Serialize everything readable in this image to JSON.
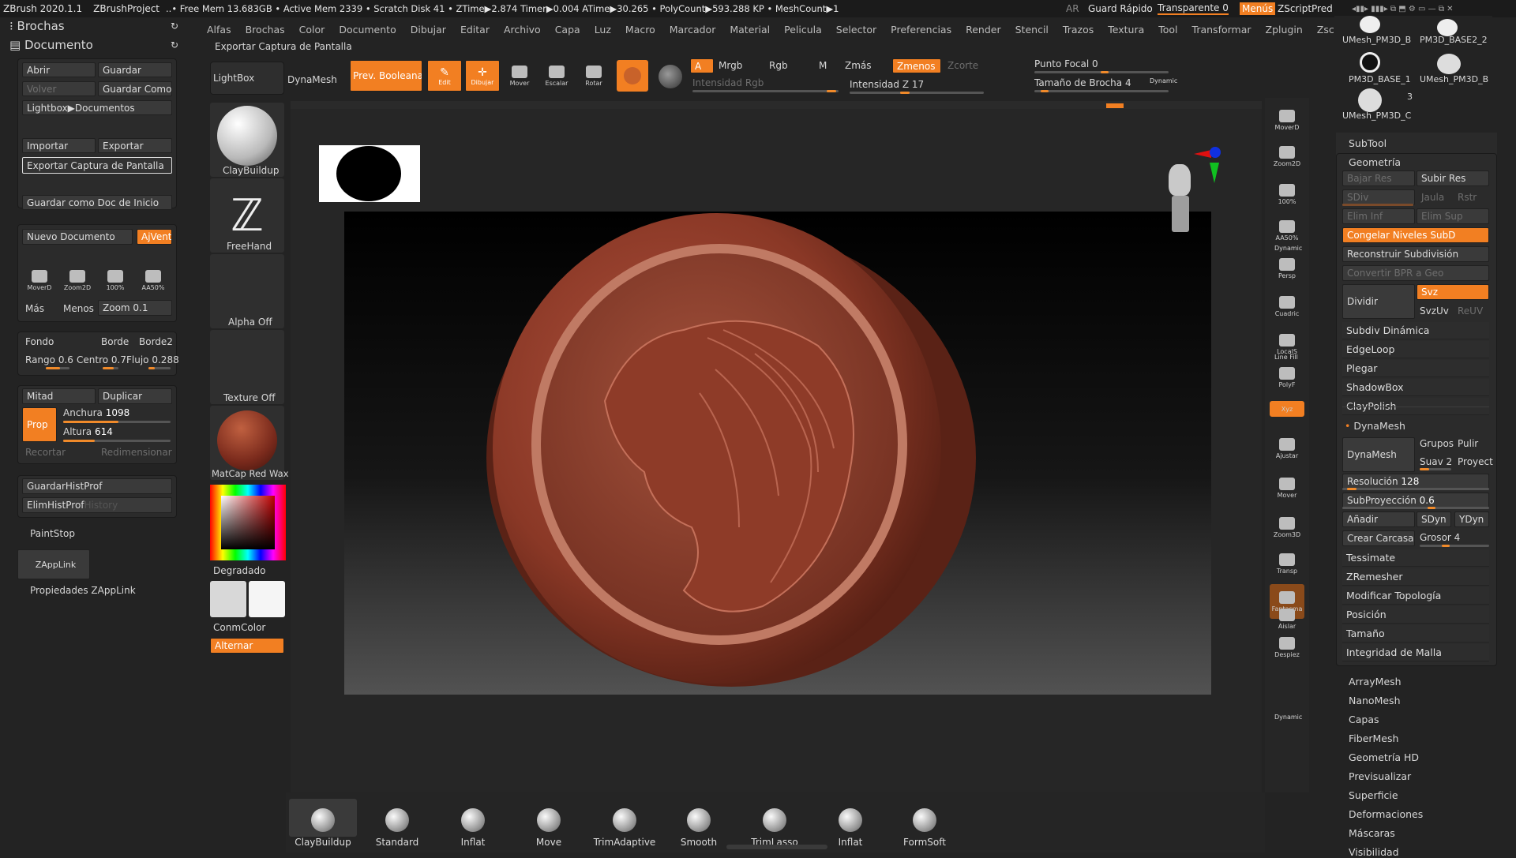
{
  "titlebar": {
    "app": "ZBrush 2020.1.1",
    "project": "ZBrushProject",
    "stats": "..• Free Mem 13.683GB • Active Mem 2339 • Scratch Disk 41 • ZTime▶2.874 Timer▶0.004 ATime▶30.265 • PolyCount▶593.288 KP • MeshCount▶1",
    "ar": "AR",
    "quicksave": "Guard Rápido",
    "transparent": "Transparente 0",
    "menus": "Menús",
    "zscript": "ZScriptPred"
  },
  "menubar": [
    "Alfas",
    "Brochas",
    "Color",
    "Documento",
    "Dibujar",
    "Editar",
    "Archivo",
    "Capa",
    "Luz",
    "Macro",
    "Marcador",
    "Material",
    "Pelicula",
    "Selector",
    "Preferencias",
    "Render",
    "Stencil",
    "Trazos",
    "Textura",
    "Tool",
    "Transformar",
    "Zplugin",
    "Zscript",
    "?"
  ],
  "left": {
    "brochas": "Brochas",
    "documento": "Documento",
    "abrir": "Abrir",
    "guardar": "Guardar",
    "volver": "Volver",
    "guardar_como": "Guardar Como",
    "lightbox_docs": "Lightbox▶Documentos",
    "importar": "Importar",
    "exportar": "Exportar",
    "exportar_captura": "Exportar Captura de Pantalla",
    "guardar_inicio": "Guardar como Doc de Inicio",
    "nuevo_doc": "Nuevo Documento",
    "ajvent": "AjVent",
    "mover": "MoverD",
    "zoom2d": "Zoom2D",
    "cien": "100%",
    "aa50": "AA50%",
    "mas": "Más",
    "menos": "Menos",
    "zoom": "Zoom",
    "zoom_val": "0.1",
    "fondo": "Fondo",
    "borde": "Borde",
    "borde2": "Borde2",
    "rango": "Rango",
    "rango_val": "0.6",
    "centro": "Centro",
    "centro_val": "0.7",
    "flujo": "Flujo",
    "flujo_val": "0.288",
    "mitad": "Mitad",
    "duplicar": "Duplicar",
    "prop": "Prop",
    "anchura": "Anchura",
    "anchura_val": "1098",
    "altura": "Altura",
    "altura_val": "614",
    "recortar": "Recortar",
    "redimensionar": "Redimensionar",
    "guardarhist": "GuardarHistProf",
    "elimhist": "ElimHistProf",
    "history": "History",
    "paintstop": "PaintStop",
    "zapplink": "ZAppLink",
    "propzapplink": "Propiedades ZAppLink"
  },
  "tooltip": "Exportar Captura de Pantalla",
  "shelf": {
    "lightbox": "LightBox",
    "dynamesh": "DynaMesh",
    "prevbool": "Prev. Booleana",
    "edit": "Edit",
    "dibujar": "Dibujar",
    "mover": "Mover",
    "escalar": "Escalar",
    "rotar": "Rotar",
    "a": "A",
    "mrgb": "Mrgb",
    "rgb": "Rgb",
    "m": "M",
    "zmas": "Zmás",
    "zmenos": "Zmenos",
    "zcorte": "Zcorte",
    "intensidad_rgb": "Intensidad Rgb",
    "intensidad_z": "Intensidad Z",
    "intensidad_z_val": "17",
    "punto_focal": "Punto Focal",
    "punto_focal_val": "0",
    "tamano_brocha": "Tamaño de Brocha",
    "tamano_brocha_val": "4",
    "dynamic": "Dynamic"
  },
  "leftshelf": {
    "claybuildup": "ClayBuildup",
    "freehand": "FreeHand",
    "alpha": "Alpha Off",
    "texture": "Texture Off",
    "matcap": "MatCap Red Wax",
    "degradado": "Degradado",
    "conmcolor": "ConmColor",
    "alternar": "Alternar"
  },
  "righttools": [
    "MoverD",
    "Zoom2D",
    "100%",
    "AA50%",
    "Persp",
    "Cuadric",
    "LocalS",
    "PolyF",
    "Xyz",
    "Ajustar",
    "Mover",
    "Zoom3D",
    "Transp",
    "Fantasma",
    "Aislar",
    "Despiez"
  ],
  "righttools_extra": {
    "dynamic": "Dynamic",
    "linefill": "Line Fill"
  },
  "subtools": {
    "a": "UMesh_PM3D_B",
    "b": "PM3D_BASE2_2",
    "c": "PM3D_BASE_1",
    "d": "UMesh_PM3D_B",
    "e": "UMesh_PM3D_C",
    "count": "3"
  },
  "right": {
    "subtool": "SubTool",
    "geometria": "Geometría",
    "bajar": "Bajar Res",
    "subir": "Subir Res",
    "sdiv": "SDiv",
    "jaula": "Jaula",
    "rstr": "Rstr",
    "eliminf": "Elim Inf",
    "elimsup": "Elim Sup",
    "congelar": "Congelar Niveles SubD",
    "reconstruir": "Reconstruir Subdivisión",
    "convertir": "Convertir BPR a Geo",
    "dividir": "Dividir",
    "svz": "Svz",
    "svzuv": "SvzUv",
    "reuv": "ReUV",
    "subdiv": "Subdiv Dinámica",
    "edgeloop": "EdgeLoop",
    "plegar": "Plegar",
    "shadowbox": "ShadowBox",
    "claypolish": "ClayPolish",
    "dynamesh_h": "DynaMesh",
    "dynamesh": "DynaMesh",
    "grupos": "Grupos",
    "pulir": "Pulir",
    "suav": "Suav",
    "suav_val": "2",
    "proyect": "Proyect",
    "resolucion": "Resolución",
    "resolucion_val": "128",
    "subproy": "SubProyección",
    "subproy_val": "0.6",
    "anadir": "Añadir",
    "sdyn": "SDyn",
    "ydyn": "YDyn",
    "carcasa": "Crear Carcasa",
    "grosor": "Grosor",
    "grosor_val": "4",
    "tessimate": "Tessimate",
    "zremesher": "ZRemesher",
    "modtopo": "Modificar Topología",
    "posicion": "Posición",
    "tamano": "Tamaño",
    "integridad": "Integridad de Malla",
    "arraymesh": "ArrayMesh",
    "nanomesh": "NanoMesh",
    "capas": "Capas",
    "fibermesh": "FiberMesh",
    "geohd": "Geometría HD",
    "previsualizar": "Previsualizar",
    "superficie": "Superficie",
    "deformaciones": "Deformaciones",
    "mascaras": "Máscaras",
    "visibilidad": "Visibilidad"
  },
  "brushes": [
    "ClayBuildup",
    "Standard",
    "Inflat",
    "Move",
    "TrimAdaptive",
    "Smooth",
    "TrimLasso",
    "Inflat",
    "FormSoft"
  ],
  "colors": {
    "accent": "#f27f22",
    "panel": "#2b2b2b",
    "bg": "#232323",
    "clay": "#8a3a2c"
  }
}
